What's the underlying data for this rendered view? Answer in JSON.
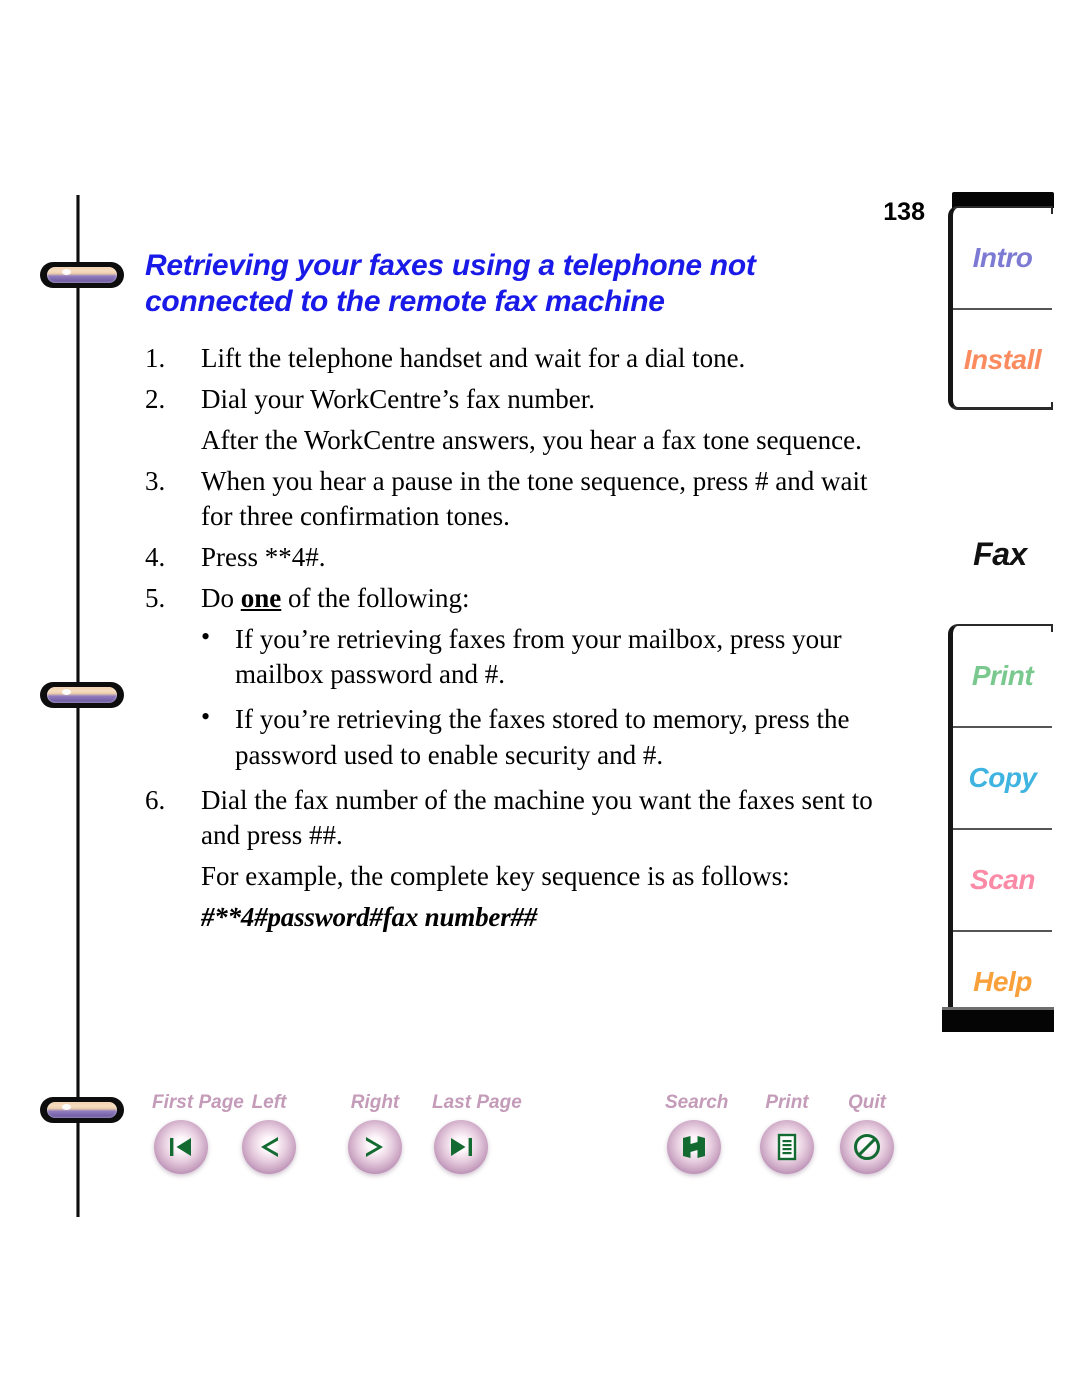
{
  "document": {
    "page_number": "138",
    "heading": "Retrieving your faxes using a telephone not connected to the remote fax machine",
    "steps": [
      {
        "num": "1.",
        "text": "Lift the telephone handset and wait for a dial tone."
      },
      {
        "num": "2.",
        "text": "Dial your WorkCentre’s fax number."
      },
      {
        "num": "3.",
        "text": "When you hear a pause in the tone sequence, press # and wait for three confirmation tones."
      },
      {
        "num": "4.",
        "text": "Press **4#."
      },
      {
        "num": "5.",
        "text": "Do one of the following:"
      },
      {
        "num": "6.",
        "text": "Dial the fax number of the machine you want the faxes sent to and press ##."
      }
    ],
    "note_after_step2": "After the WorkCentre answers, you hear a fax tone sequence.",
    "step5_label_prefix": "Do ",
    "step5_emphasis": "one",
    "step5_label_suffix": " of the following:",
    "bullets": [
      {
        "marker": "•",
        "text": "If you’re retrieving faxes from your mailbox, press your mailbox password and #."
      },
      {
        "marker": "•",
        "text": "If you’re retrieving the faxes stored to memory, press the password used to enable security and #."
      }
    ],
    "example_intro": "For example, the complete key sequence is as follows:",
    "example_sequence": "#**4#password#fax number##"
  },
  "navigation": {
    "buttons": [
      {
        "label": "First Page",
        "icon": "first-page-icon"
      },
      {
        "label": "Left",
        "icon": "previous-page-icon"
      },
      {
        "label": "Right",
        "icon": "next-page-icon"
      },
      {
        "label": "Last Page",
        "icon": "last-page-icon"
      },
      {
        "label": "Search",
        "icon": "search-binoculars-icon"
      },
      {
        "label": "Print",
        "icon": "print-document-icon"
      },
      {
        "label": "Quit",
        "icon": "quit-prohibited-icon"
      }
    ],
    "label_color": "#c49bb8",
    "glyph_color": "#136b32"
  },
  "tabs": {
    "active": "Fax",
    "active_color": "#111111",
    "items": [
      {
        "label": "Intro",
        "color": "#7d7ad4"
      },
      {
        "label": "Install",
        "color": "#fa8b5f"
      },
      {
        "label": "Print",
        "color": "#79c98e"
      },
      {
        "label": "Copy",
        "color": "#3fb4e0"
      },
      {
        "label": "Scan",
        "color": "#fb8aa6"
      },
      {
        "label": "Help",
        "color": "#f9a03a"
      }
    ]
  },
  "binder": {
    "ring_count": 3
  }
}
